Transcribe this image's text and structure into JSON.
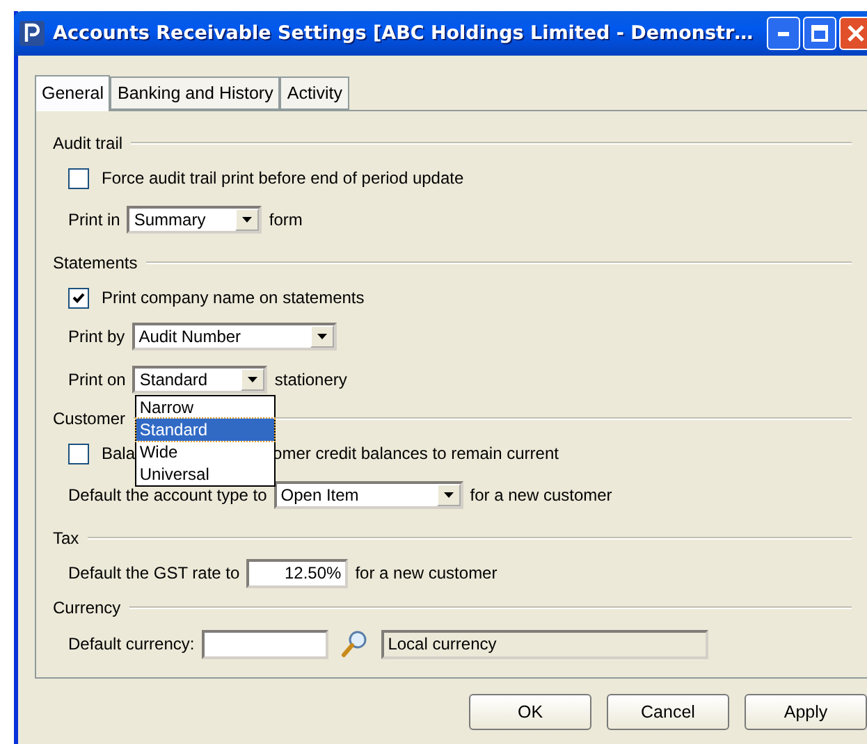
{
  "window": {
    "title": "Accounts Receivable Settings [ABC Holdings Limited - Demonstr…"
  },
  "tabs": [
    {
      "label": "General",
      "selected": true
    },
    {
      "label": "Banking and History",
      "selected": false
    },
    {
      "label": "Activity",
      "selected": false
    }
  ],
  "sections": [
    {
      "title": "Audit trail",
      "rows": [
        {
          "kind": "checkbox",
          "label": "Force audit trail print before end of period update",
          "checked": false
        },
        {
          "kind": "combo",
          "before": "Print in",
          "value": "Summary",
          "after": "form"
        }
      ]
    },
    {
      "title": "Statements",
      "rows": [
        {
          "kind": "checkbox",
          "label": "Print company name on statements",
          "checked": true
        },
        {
          "kind": "combo",
          "before": "Print by",
          "value": "Audit Number"
        },
        {
          "kind": "combo",
          "before": "Print on",
          "value": "Standard",
          "after": "stationery",
          "open": true,
          "options": [
            {
              "label": "Narrow",
              "selected": false
            },
            {
              "label": "Standard",
              "selected": true
            },
            {
              "label": "Wide",
              "selected": false
            },
            {
              "label": "Universal",
              "selected": false
            }
          ]
        }
      ]
    },
    {
      "title": "Customer",
      "rows": [
        {
          "kind": "checkbox",
          "label_parts": [
            "Bala",
            "omer credit balances to remain current"
          ],
          "checked": false
        },
        {
          "kind": "combo",
          "before": "Default the account type to",
          "value": "Open Item",
          "after": "for a new customer"
        }
      ]
    },
    {
      "title": "Tax",
      "rows": [
        {
          "kind": "input",
          "before": "Default the GST rate to",
          "value": "12.50%",
          "after": "for a new customer"
        }
      ]
    },
    {
      "title": "Currency",
      "rows": [
        {
          "kind": "lookup",
          "before": "Default currency:",
          "description": "Local currency"
        }
      ]
    }
  ],
  "buttons": [
    {
      "label": "OK"
    },
    {
      "label": "Cancel"
    },
    {
      "label": "Apply"
    }
  ]
}
